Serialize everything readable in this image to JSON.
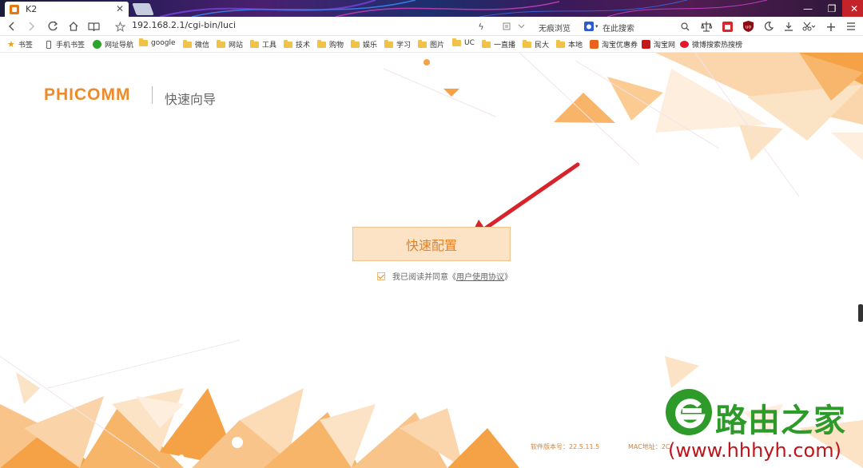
{
  "browser": {
    "tab_title": "K2",
    "address": "192.168.2.1/cgi-bin/luci",
    "mode_label": "无痕浏览",
    "search_placeholder": "在此搜索"
  },
  "bookmarks": {
    "items": [
      "书签",
      "手机书签",
      "网址导航",
      "google",
      "微信",
      "网站",
      "工具",
      "技术",
      "购物",
      "娱乐",
      "学习",
      "图片",
      "UC",
      "一直播",
      "民大",
      "本地",
      "淘宝优惠券",
      "淘宝网",
      "微博搜索热搜榜"
    ]
  },
  "page": {
    "brand": "PHICOMM",
    "subtitle": "快速向导",
    "quick_setup_button": "快速配置",
    "agree_prefix": "我已阅读并同意《",
    "agree_link": "用户使用协议",
    "agree_suffix": "》",
    "firmware_label": "软件版本号：22.5.11.5",
    "mac_label": "MAC地址：2C:"
  },
  "watermark": {
    "title": "路由之家",
    "url": "(www.hhhyh.com)"
  },
  "colors": {
    "accent": "#ee8a2a",
    "button_bg": "#fce3c6",
    "arrow": "#d8232a",
    "watermark_green": "#2d9a2a",
    "watermark_red": "#c0141b"
  }
}
